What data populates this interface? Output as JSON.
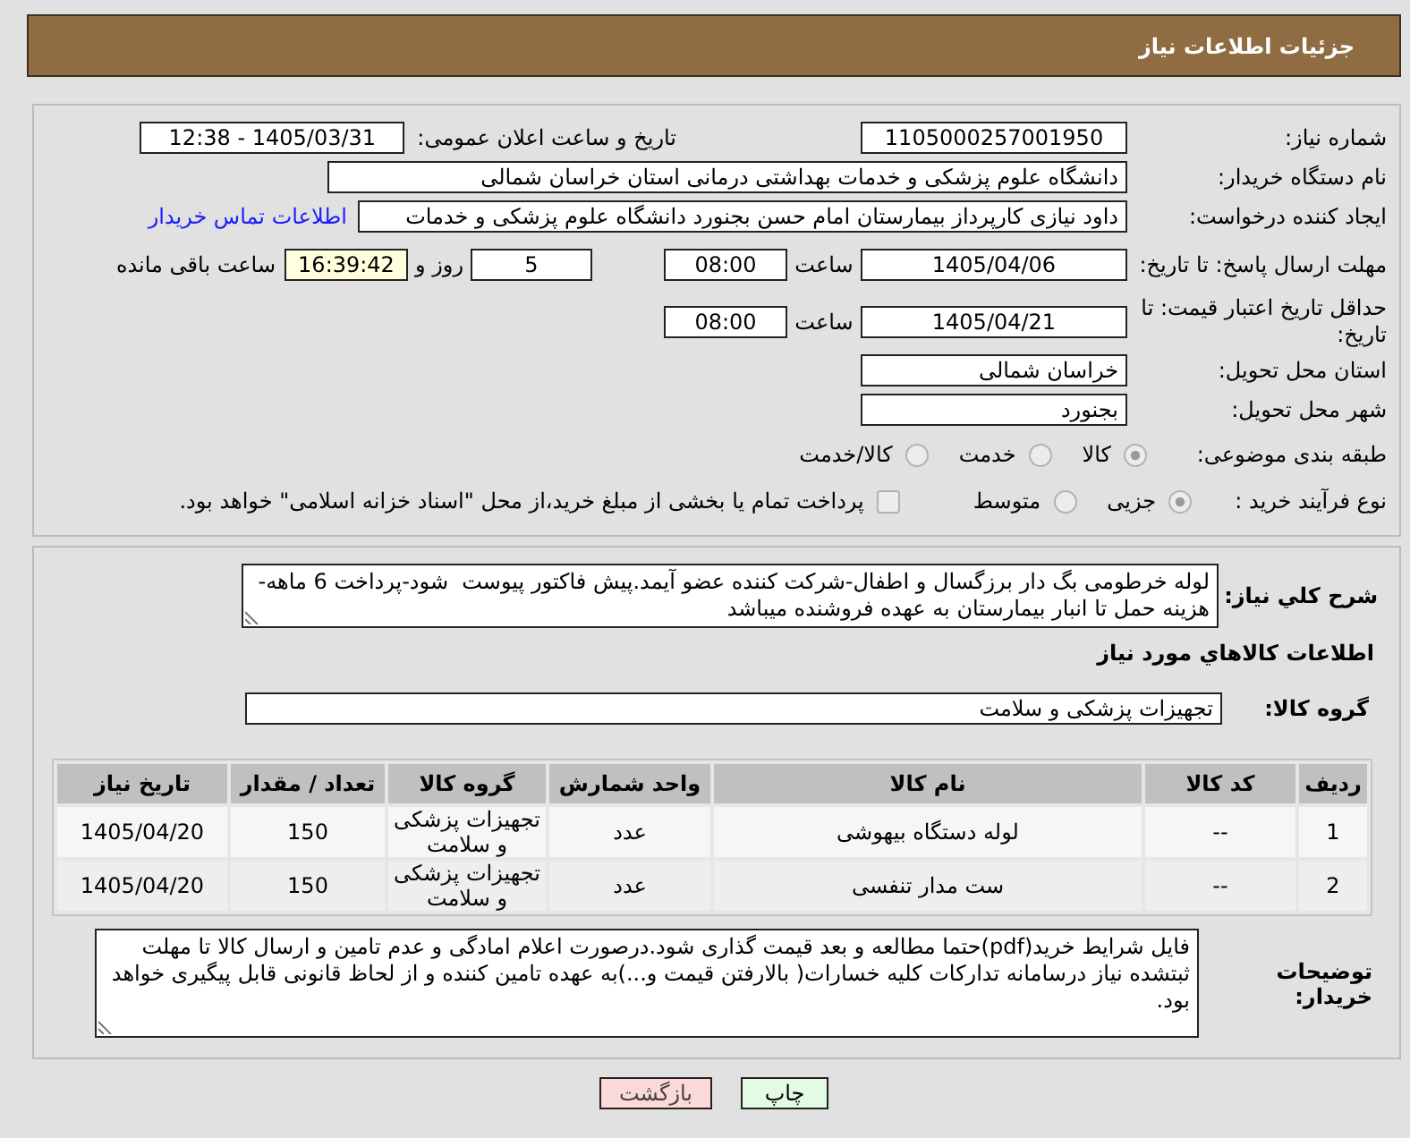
{
  "header": {
    "title": "جزئیات اطلاعات نیاز"
  },
  "need_number": {
    "label": "شماره نیاز:",
    "value": "1105000257001950"
  },
  "announcement": {
    "label": "تاریخ و ساعت اعلان عمومی:",
    "value": "1405/03/31 - 12:38"
  },
  "buyer_organization": {
    "label": "نام دستگاه خریدار:",
    "value": "دانشگاه علوم پزشکی و خدمات بهداشتی درمانی استان خراسان شمالی"
  },
  "requester": {
    "label": "ایجاد کننده درخواست:",
    "value": "داود نیازی کارپرداز بیمارستان امام حسن بجنورد دانشگاه علوم پزشکی و خدمات",
    "contact_link": "اطلاعات تماس خریدار"
  },
  "response_deadline": {
    "label": "مهلت ارسال پاسخ: تا تاریخ:",
    "date": "1405/04/06",
    "time_label": "ساعت",
    "time": "08:00",
    "days": "5",
    "days_label": "روز و",
    "remaining_time": "16:39:42",
    "remaining_label": "ساعت باقی مانده"
  },
  "price_validity": {
    "label": "حداقل تاریخ اعتبار قیمت: تا تاریخ:",
    "date": "1405/04/21",
    "time_label": "ساعت",
    "time": "08:00"
  },
  "delivery_province": {
    "label": "استان محل تحویل:",
    "value": "خراسان شمالی"
  },
  "delivery_city": {
    "label": "شهر محل تحویل:",
    "value": "بجنورد"
  },
  "subject_category": {
    "label": "طبقه بندی موضوعی:",
    "options": [
      {
        "label": "کالا",
        "selected": true,
        "disabled": true
      },
      {
        "label": "خدمت",
        "selected": false,
        "disabled": true
      },
      {
        "label": "کالا/خدمت",
        "selected": false,
        "disabled": true
      }
    ]
  },
  "purchase_process": {
    "label": "نوع فرآیند خرید :",
    "options": [
      {
        "label": "جزیی",
        "selected": true,
        "disabled": true
      },
      {
        "label": "متوسط",
        "selected": false,
        "disabled": true
      }
    ],
    "treasury_payment": {
      "label": "پرداخت تمام یا بخشی از مبلغ خرید،از محل \"اسناد خزانه اسلامی\" خواهد بود.",
      "checked": false,
      "disabled": true
    }
  },
  "description": {
    "label": "شرح کلي نیاز:",
    "value": "لوله خرطومی بگ دار برزگسال و اطفال-شرکت کننده عضو آیمد.پیش فاکتور پیوست  شود-پرداخت 6 ماهه-هزینه حمل تا انبار بیمارستان به عهده فروشنده میباشد"
  },
  "goods_title": "اطلاعات کالاهاي مورد نیاز",
  "goods_group": {
    "label": "گروه کالا:",
    "value": "تجهیزات پزشکی و سلامت"
  },
  "table": {
    "columns": [
      "ردیف",
      "کد کالا",
      "نام کالا",
      "واحد شمارش",
      "گروه کالا",
      "تعداد / مقدار",
      "تاریخ نیاز"
    ],
    "rows": [
      [
        "1",
        "--",
        "لوله دستگاه بیهوشی",
        "عدد",
        "تجهیزات پزشکی و سلامت",
        "150",
        "1405/04/20"
      ],
      [
        "2",
        "--",
        "ست مدار تنفسی",
        "عدد",
        "تجهیزات پزشکی و سلامت",
        "150",
        "1405/04/20"
      ]
    ]
  },
  "buyer_notes": {
    "label": "توضیحات خریدار:",
    "value": "فایل شرایط خرید(pdf)حتما مطالعه و بعد قیمت گذاری شود.درصورت اعلام امادگی و عدم تامین و ارسال کالا تا مهلت ثبتشده نیاز درسامانه تدارکات کلیه خسارات( بالارفتن قیمت و...)به عهده تامین کننده و از لحاظ قانونی قابل پیگیری خواهد بود."
  },
  "buttons": [
    {
      "label": "چاپ",
      "kind": "print"
    },
    {
      "label": "بازگشت",
      "kind": "back"
    }
  ]
}
